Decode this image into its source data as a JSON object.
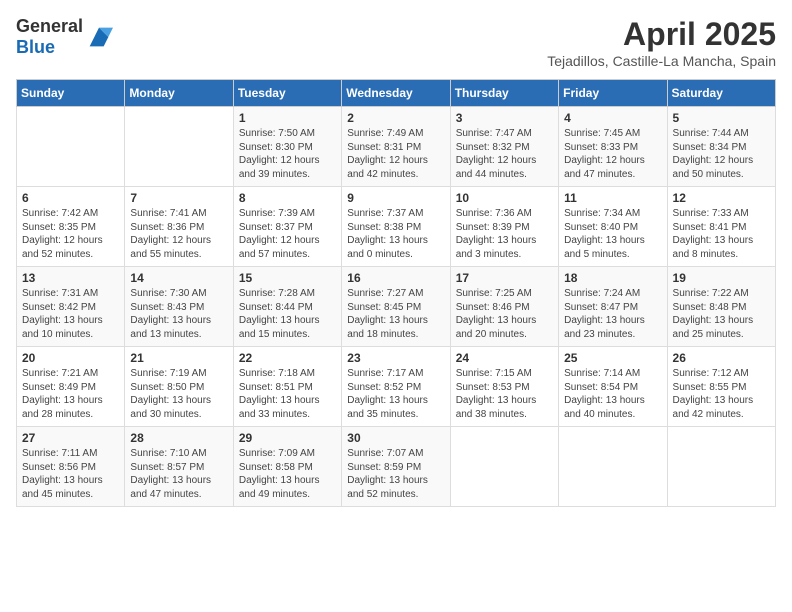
{
  "header": {
    "logo_general": "General",
    "logo_blue": "Blue",
    "month": "April 2025",
    "location": "Tejadillos, Castille-La Mancha, Spain"
  },
  "days_of_week": [
    "Sunday",
    "Monday",
    "Tuesday",
    "Wednesday",
    "Thursday",
    "Friday",
    "Saturday"
  ],
  "weeks": [
    [
      {
        "day": null
      },
      {
        "day": null
      },
      {
        "day": 1,
        "sunrise": "Sunrise: 7:50 AM",
        "sunset": "Sunset: 8:30 PM",
        "daylight": "Daylight: 12 hours and 39 minutes."
      },
      {
        "day": 2,
        "sunrise": "Sunrise: 7:49 AM",
        "sunset": "Sunset: 8:31 PM",
        "daylight": "Daylight: 12 hours and 42 minutes."
      },
      {
        "day": 3,
        "sunrise": "Sunrise: 7:47 AM",
        "sunset": "Sunset: 8:32 PM",
        "daylight": "Daylight: 12 hours and 44 minutes."
      },
      {
        "day": 4,
        "sunrise": "Sunrise: 7:45 AM",
        "sunset": "Sunset: 8:33 PM",
        "daylight": "Daylight: 12 hours and 47 minutes."
      },
      {
        "day": 5,
        "sunrise": "Sunrise: 7:44 AM",
        "sunset": "Sunset: 8:34 PM",
        "daylight": "Daylight: 12 hours and 50 minutes."
      }
    ],
    [
      {
        "day": 6,
        "sunrise": "Sunrise: 7:42 AM",
        "sunset": "Sunset: 8:35 PM",
        "daylight": "Daylight: 12 hours and 52 minutes."
      },
      {
        "day": 7,
        "sunrise": "Sunrise: 7:41 AM",
        "sunset": "Sunset: 8:36 PM",
        "daylight": "Daylight: 12 hours and 55 minutes."
      },
      {
        "day": 8,
        "sunrise": "Sunrise: 7:39 AM",
        "sunset": "Sunset: 8:37 PM",
        "daylight": "Daylight: 12 hours and 57 minutes."
      },
      {
        "day": 9,
        "sunrise": "Sunrise: 7:37 AM",
        "sunset": "Sunset: 8:38 PM",
        "daylight": "Daylight: 13 hours and 0 minutes."
      },
      {
        "day": 10,
        "sunrise": "Sunrise: 7:36 AM",
        "sunset": "Sunset: 8:39 PM",
        "daylight": "Daylight: 13 hours and 3 minutes."
      },
      {
        "day": 11,
        "sunrise": "Sunrise: 7:34 AM",
        "sunset": "Sunset: 8:40 PM",
        "daylight": "Daylight: 13 hours and 5 minutes."
      },
      {
        "day": 12,
        "sunrise": "Sunrise: 7:33 AM",
        "sunset": "Sunset: 8:41 PM",
        "daylight": "Daylight: 13 hours and 8 minutes."
      }
    ],
    [
      {
        "day": 13,
        "sunrise": "Sunrise: 7:31 AM",
        "sunset": "Sunset: 8:42 PM",
        "daylight": "Daylight: 13 hours and 10 minutes."
      },
      {
        "day": 14,
        "sunrise": "Sunrise: 7:30 AM",
        "sunset": "Sunset: 8:43 PM",
        "daylight": "Daylight: 13 hours and 13 minutes."
      },
      {
        "day": 15,
        "sunrise": "Sunrise: 7:28 AM",
        "sunset": "Sunset: 8:44 PM",
        "daylight": "Daylight: 13 hours and 15 minutes."
      },
      {
        "day": 16,
        "sunrise": "Sunrise: 7:27 AM",
        "sunset": "Sunset: 8:45 PM",
        "daylight": "Daylight: 13 hours and 18 minutes."
      },
      {
        "day": 17,
        "sunrise": "Sunrise: 7:25 AM",
        "sunset": "Sunset: 8:46 PM",
        "daylight": "Daylight: 13 hours and 20 minutes."
      },
      {
        "day": 18,
        "sunrise": "Sunrise: 7:24 AM",
        "sunset": "Sunset: 8:47 PM",
        "daylight": "Daylight: 13 hours and 23 minutes."
      },
      {
        "day": 19,
        "sunrise": "Sunrise: 7:22 AM",
        "sunset": "Sunset: 8:48 PM",
        "daylight": "Daylight: 13 hours and 25 minutes."
      }
    ],
    [
      {
        "day": 20,
        "sunrise": "Sunrise: 7:21 AM",
        "sunset": "Sunset: 8:49 PM",
        "daylight": "Daylight: 13 hours and 28 minutes."
      },
      {
        "day": 21,
        "sunrise": "Sunrise: 7:19 AM",
        "sunset": "Sunset: 8:50 PM",
        "daylight": "Daylight: 13 hours and 30 minutes."
      },
      {
        "day": 22,
        "sunrise": "Sunrise: 7:18 AM",
        "sunset": "Sunset: 8:51 PM",
        "daylight": "Daylight: 13 hours and 33 minutes."
      },
      {
        "day": 23,
        "sunrise": "Sunrise: 7:17 AM",
        "sunset": "Sunset: 8:52 PM",
        "daylight": "Daylight: 13 hours and 35 minutes."
      },
      {
        "day": 24,
        "sunrise": "Sunrise: 7:15 AM",
        "sunset": "Sunset: 8:53 PM",
        "daylight": "Daylight: 13 hours and 38 minutes."
      },
      {
        "day": 25,
        "sunrise": "Sunrise: 7:14 AM",
        "sunset": "Sunset: 8:54 PM",
        "daylight": "Daylight: 13 hours and 40 minutes."
      },
      {
        "day": 26,
        "sunrise": "Sunrise: 7:12 AM",
        "sunset": "Sunset: 8:55 PM",
        "daylight": "Daylight: 13 hours and 42 minutes."
      }
    ],
    [
      {
        "day": 27,
        "sunrise": "Sunrise: 7:11 AM",
        "sunset": "Sunset: 8:56 PM",
        "daylight": "Daylight: 13 hours and 45 minutes."
      },
      {
        "day": 28,
        "sunrise": "Sunrise: 7:10 AM",
        "sunset": "Sunset: 8:57 PM",
        "daylight": "Daylight: 13 hours and 47 minutes."
      },
      {
        "day": 29,
        "sunrise": "Sunrise: 7:09 AM",
        "sunset": "Sunset: 8:58 PM",
        "daylight": "Daylight: 13 hours and 49 minutes."
      },
      {
        "day": 30,
        "sunrise": "Sunrise: 7:07 AM",
        "sunset": "Sunset: 8:59 PM",
        "daylight": "Daylight: 13 hours and 52 minutes."
      },
      {
        "day": null
      },
      {
        "day": null
      },
      {
        "day": null
      }
    ]
  ]
}
